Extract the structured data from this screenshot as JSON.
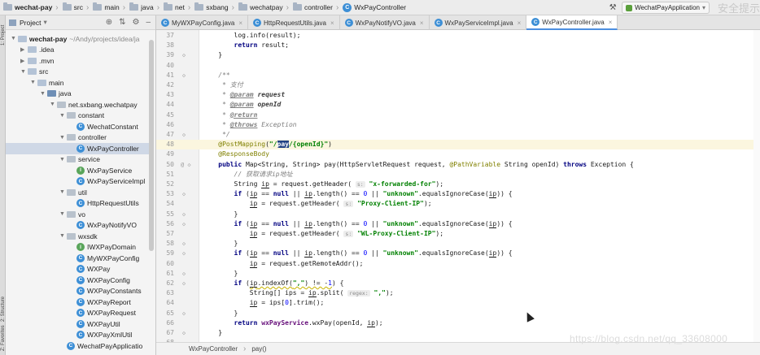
{
  "breadcrumb": [
    {
      "label": "wechat-pay",
      "strong": true
    },
    {
      "label": "src"
    },
    {
      "label": "main"
    },
    {
      "label": "java"
    },
    {
      "label": "net"
    },
    {
      "label": "sxbang"
    },
    {
      "label": "wechatpay"
    },
    {
      "label": "controller"
    },
    {
      "label": "WxPayController",
      "cls": true
    }
  ],
  "toolbar": {
    "run_config": "WechatPayApplication",
    "watermark_top": "安全提示"
  },
  "project_panel": {
    "title": "Project",
    "tree": [
      {
        "depth": 0,
        "arrow": "▼",
        "icon": "dir",
        "label": "wechat-pay",
        "extra": "~/Andy/projects/idea/ja",
        "bold": true
      },
      {
        "depth": 1,
        "arrow": "▶",
        "icon": "dir",
        "label": ".idea"
      },
      {
        "depth": 1,
        "arrow": "▶",
        "icon": "dir",
        "label": ".mvn"
      },
      {
        "depth": 1,
        "arrow": "▼",
        "icon": "dir",
        "label": "src"
      },
      {
        "depth": 2,
        "arrow": "▼",
        "icon": "dir",
        "label": "main"
      },
      {
        "depth": 3,
        "arrow": "▼",
        "icon": "src",
        "label": "java"
      },
      {
        "depth": 4,
        "arrow": "▼",
        "icon": "pkg",
        "label": "net.sxbang.wechatpay"
      },
      {
        "depth": 5,
        "arrow": "▼",
        "icon": "pkg",
        "label": "constant"
      },
      {
        "depth": 6,
        "arrow": "",
        "icon": "class",
        "label": "WechatConstant"
      },
      {
        "depth": 5,
        "arrow": "▼",
        "icon": "pkg",
        "label": "controller"
      },
      {
        "depth": 6,
        "arrow": "",
        "icon": "class",
        "label": "WxPayController",
        "selected": true
      },
      {
        "depth": 5,
        "arrow": "▼",
        "icon": "pkg",
        "label": "service"
      },
      {
        "depth": 6,
        "arrow": "",
        "icon": "iface",
        "label": "WxPayService"
      },
      {
        "depth": 6,
        "arrow": "",
        "icon": "class",
        "label": "WxPayServiceImpl"
      },
      {
        "depth": 5,
        "arrow": "▼",
        "icon": "pkg",
        "label": "util"
      },
      {
        "depth": 6,
        "arrow": "",
        "icon": "class",
        "label": "HttpRequestUtils"
      },
      {
        "depth": 5,
        "arrow": "▼",
        "icon": "pkg",
        "label": "vo"
      },
      {
        "depth": 6,
        "arrow": "",
        "icon": "class",
        "label": "WxPayNotifyVO"
      },
      {
        "depth": 5,
        "arrow": "▼",
        "icon": "pkg",
        "label": "wxsdk"
      },
      {
        "depth": 6,
        "arrow": "",
        "icon": "iface",
        "label": "IWXPayDomain"
      },
      {
        "depth": 6,
        "arrow": "",
        "icon": "class",
        "label": "MyWXPayConfig"
      },
      {
        "depth": 6,
        "arrow": "",
        "icon": "class",
        "label": "WXPay"
      },
      {
        "depth": 6,
        "arrow": "",
        "icon": "class",
        "label": "WXPayConfig"
      },
      {
        "depth": 6,
        "arrow": "",
        "icon": "class",
        "label": "WXPayConstants"
      },
      {
        "depth": 6,
        "arrow": "",
        "icon": "class",
        "label": "WXPayReport"
      },
      {
        "depth": 6,
        "arrow": "",
        "icon": "class",
        "label": "WXPayRequest"
      },
      {
        "depth": 6,
        "arrow": "",
        "icon": "class",
        "label": "WXPayUtil"
      },
      {
        "depth": 6,
        "arrow": "",
        "icon": "class",
        "label": "WXPayXmlUtil"
      },
      {
        "depth": 5,
        "arrow": "",
        "icon": "class",
        "label": "WechatPayApplicatio"
      }
    ]
  },
  "tabs": [
    {
      "label": "MyWXPayConfig.java"
    },
    {
      "label": "HttpRequestUtils.java"
    },
    {
      "label": "WxPayNotifyVO.java"
    },
    {
      "label": "WxPayServiceImpl.java"
    },
    {
      "label": "WxPayController.java",
      "active": true
    }
  ],
  "editor": {
    "lines": [
      {
        "n": "37",
        "html": "        log.info(result);"
      },
      {
        "n": "38",
        "html": "        <span class=\"kw\">return</span> result;"
      },
      {
        "n": "39",
        "html": "    }",
        "mk": "◇"
      },
      {
        "n": "40",
        "html": ""
      },
      {
        "n": "41",
        "html": "    <span class=\"cm\">/**</span>",
        "mk": "◇"
      },
      {
        "n": "42",
        "html": "<span class=\"cm\">     * 支付</span>"
      },
      {
        "n": "43",
        "html": "<span class=\"cm\">     * </span><span class=\"doctag\">@param</span> <span class=\"param\">request</span>"
      },
      {
        "n": "44",
        "html": "<span class=\"cm\">     * </span><span class=\"doctag\">@param</span> <span class=\"param\">openId</span>"
      },
      {
        "n": "45",
        "html": "<span class=\"cm\">     * </span><span class=\"doctag\">@return</span>"
      },
      {
        "n": "46",
        "html": "<span class=\"cm\">     * </span><span class=\"doctag\">@throws</span> <span class=\"cm\">Exception</span>"
      },
      {
        "n": "47",
        "html": "<span class=\"cm\">     */</span>",
        "mk": "◇"
      },
      {
        "n": "48",
        "html": "    <span class=\"ann\">@PostMapping</span>(<span class=\"str\">\"/<span class=\"selword\">pay</span>/{openId}\"</span>)",
        "hl": true
      },
      {
        "n": "49",
        "html": "    <span class=\"ann\">@ResponseBody</span>"
      },
      {
        "n": "50",
        "html": "    <span class=\"kw\">public</span> Map&lt;String, String&gt; pay(HttpServletRequest request, <span class=\"ann\">@PathVariable</span> String openId) <span class=\"kw\">throws</span> Exception {",
        "mk": "@ ◇"
      },
      {
        "n": "51",
        "html": "        <span class=\"cm\">// 获取请求ip地址</span>"
      },
      {
        "n": "52",
        "html": "        String <span class=\"varul\">ip</span> = request.getHeader( <span class=\"hint\">s:</span> <span class=\"str\">\"x-forwarded-for\"</span>);"
      },
      {
        "n": "53",
        "html": "        <span class=\"kw\">if</span> (<span class=\"varul\">ip</span> == <span class=\"kw\">null</span> || <span class=\"varul\">ip</span>.length() == <span class=\"num\">0</span> || <span class=\"str\">\"unknown\"</span>.equalsIgnoreCase(<span class=\"varul\">ip</span>)) {",
        "mk": "◇"
      },
      {
        "n": "54",
        "html": "            <span class=\"varul\">ip</span> = request.getHeader( <span class=\"hint\">s:</span> <span class=\"str\">\"Proxy-Client-IP\"</span>);"
      },
      {
        "n": "55",
        "html": "        }",
        "mk": "◇"
      },
      {
        "n": "56",
        "html": "        <span class=\"kw\">if</span> (<span class=\"varul\">ip</span> == <span class=\"kw\">null</span> || <span class=\"varul\">ip</span>.length() == <span class=\"num\">0</span> || <span class=\"str\">\"unknown\"</span>.equalsIgnoreCase(<span class=\"varul\">ip</span>)) {",
        "mk": "◇"
      },
      {
        "n": "57",
        "html": "            <span class=\"varul\">ip</span> = request.getHeader( <span class=\"hint\">s:</span> <span class=\"str\">\"WL-Proxy-Client-IP\"</span>);"
      },
      {
        "n": "58",
        "html": "        }",
        "mk": "◇"
      },
      {
        "n": "59",
        "html": "        <span class=\"kw\">if</span> (<span class=\"varul\">ip</span> == <span class=\"kw\">null</span> || <span class=\"varul\">ip</span>.length() == <span class=\"num\">0</span> || <span class=\"str\">\"unknown\"</span>.equalsIgnoreCase(<span class=\"varul\">ip</span>)) {",
        "mk": "◇"
      },
      {
        "n": "60",
        "html": "            <span class=\"varul\">ip</span> = request.getRemoteAddr();"
      },
      {
        "n": "61",
        "html": "        }",
        "mk": "◇"
      },
      {
        "n": "62",
        "html": "        <span class=\"kw\">if</span> (<span class=\"squig\"><span class=\"varul\">ip</span>.indexOf(<span class=\"str\">\",\"</span>) != -<span class=\"num\">1</span></span>) {",
        "mk": "◇"
      },
      {
        "n": "63",
        "html": "            String[] ips = <span class=\"varul\">ip</span>.split( <span class=\"hint\">regex:</span> <span class=\"str\">\",\"</span>);"
      },
      {
        "n": "64",
        "html": "            <span class=\"varul\">ip</span> = ips[<span class=\"num\">0</span>].trim();"
      },
      {
        "n": "65",
        "html": "        }",
        "mk": "◇"
      },
      {
        "n": "66",
        "html": "        <span class=\"kw\">return</span> <span class=\"fld\">wxPayService</span>.wxPay(openId, <span class=\"varul\">ip</span>);"
      },
      {
        "n": "67",
        "html": "    }",
        "mk": "◇"
      },
      {
        "n": "68",
        "html": ""
      },
      {
        "n": "69",
        "html": ""
      }
    ]
  },
  "status_breadcrumb": {
    "cls": "WxPayController",
    "method": "pay()"
  },
  "watermark": "https://blog.csdn.net/qq_33608000",
  "left_strip": [
    "1: Project",
    "2: Structure",
    "Z: Favorites"
  ]
}
